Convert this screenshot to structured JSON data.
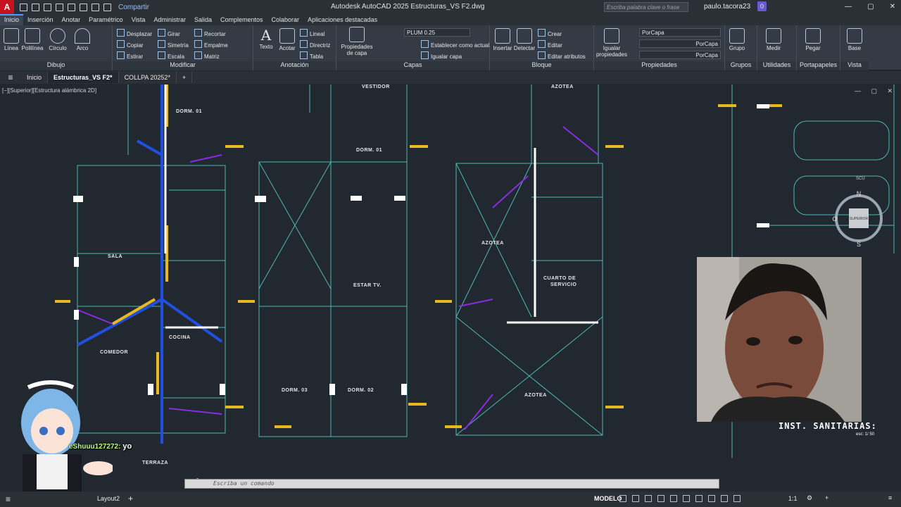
{
  "titlebar": {
    "logo": "A",
    "share": "Compartir",
    "title": "Autodesk AutoCAD 2025   Estructuras_VS F2.dwg",
    "search_placeholder": "Escriba palabra clave o frase",
    "user": "paulo.tacora23",
    "notifications": "0"
  },
  "ribbon_tabs": [
    "Inicio",
    "Inserción",
    "Anotar",
    "Paramétrico",
    "Vista",
    "Administrar",
    "Salida",
    "Complementos",
    "Colaborar",
    "Aplicaciones destacadas"
  ],
  "panels": {
    "dibujo": {
      "title": "Dibujo",
      "tools": [
        "Línea",
        "Polilínea",
        "Círculo",
        "Arco"
      ]
    },
    "modificar": {
      "title": "Modificar",
      "tools": [
        "Desplazar",
        "Girar",
        "Recortar",
        "Copiar",
        "Simetría",
        "Empalme",
        "Estirar",
        "Escala",
        "Matriz"
      ]
    },
    "anotacion": {
      "title": "Anotación",
      "tools": [
        "Texto",
        "Acotar",
        "Lineal",
        "Directriz",
        "Tabla"
      ]
    },
    "capas": {
      "title": "Capas",
      "props_label": "Propiedades de capa",
      "current_layer": "PLUM 0.25",
      "set_current": "Establecer como actual",
      "match_layer": "Igualar capa"
    },
    "bloque": {
      "title": "Bloque",
      "tools": [
        "Insertar",
        "Detectar",
        "Crear",
        "Editar",
        "Editar atributos"
      ]
    },
    "propiedades": {
      "title": "Propiedades",
      "match": "Igualar propiedades",
      "color": "PorCapa",
      "linetype": "PorCapa",
      "lineweight": "PorCapa"
    },
    "grupos": {
      "title": "Grupos",
      "tool": "Grupo"
    },
    "utilidades": {
      "title": "Utilidades",
      "tool": "Medir"
    },
    "portapapeles": {
      "title": "Portapapeles",
      "tool": "Pegar"
    },
    "vista": {
      "title": "Vista",
      "tool": "Base"
    }
  },
  "doc_tabs": {
    "start": "Inicio",
    "tabs": [
      "Estructuras_VS F2*",
      "COLLPA 20252*"
    ]
  },
  "viewport": {
    "label": "[−][Superior][Estructura alámbrica 2D]",
    "rooms": [
      "DORM. 01",
      "SALA",
      "COCINA",
      "COMEDOR",
      "TERRAZA",
      "VESTIDOR",
      "DORM. 01",
      "ESTAR TV.",
      "DORM. 03",
      "DORM. 02",
      "AZOTEA",
      "AZOTEA",
      "CUARTO DE",
      "SERVICIO",
      "AZOTEA",
      "AZOTEA"
    ],
    "viewcube": {
      "face": "SUPERIOR",
      "north": "N",
      "south": "S",
      "west": "O",
      "ucs": "SCU"
    }
  },
  "overlay": {
    "sheet_title": "INST. SANITARIAS: ",
    "sheet_scale": "esc: 1/ 50",
    "chat_user": "eShuuu127272:",
    "chat_msg": " yo"
  },
  "command": {
    "placeholder": "Escriba un comando"
  },
  "status": {
    "layout": "Layout2",
    "model": "MODELO",
    "scale": "1:1"
  }
}
